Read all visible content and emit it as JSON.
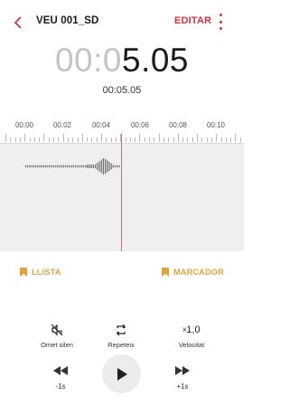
{
  "header": {
    "back_icon": "chevron-left-icon",
    "title": "VEU 001_SD",
    "edit_label": "EDITAR",
    "more_icon": "more-vertical-icon",
    "accent_color": "#d6343c"
  },
  "timer": {
    "dim_part": "00:0",
    "bright_part": "5.05",
    "total": "00:05.05"
  },
  "timeline": {
    "labels": [
      "00:00",
      "00:02",
      "00:04",
      "00:06",
      "00:08",
      "00:10"
    ]
  },
  "bookmarks": {
    "list_label": "LLISTA",
    "marker_label": "MARCADOR",
    "color": "#e3a23a"
  },
  "tools": {
    "skip_silence_label": "Omet silen",
    "repeat_label": "Repeteix",
    "speed_value": "1,0",
    "speed_prefix": "x",
    "speed_label": "Velocitat"
  },
  "controls": {
    "rewind_label": "-1s",
    "forward_label": "+1s",
    "play_icon": "play-icon"
  }
}
